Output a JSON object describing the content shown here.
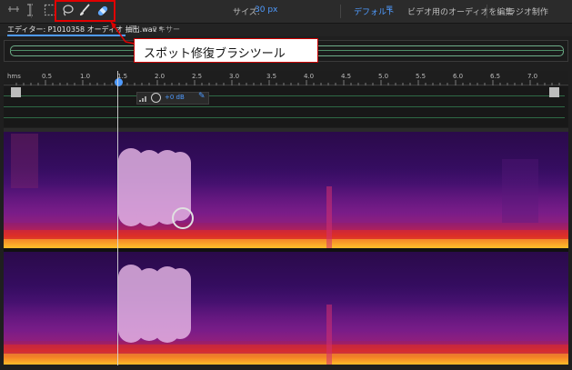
{
  "toolbar": {
    "tools": [
      {
        "icon": "waveform-view-icon"
      },
      {
        "icon": "time-selection-icon"
      },
      {
        "icon": "marquee-selection-icon"
      },
      {
        "icon": "lasso-selection-icon"
      },
      {
        "icon": "paintbrush-selection-icon"
      },
      {
        "icon": "spot-healing-brush-icon",
        "active": true
      }
    ],
    "size_label": "サイズ:",
    "size_value": "30 px",
    "workspace_default": "デフォルト",
    "workspace_menu": "≡",
    "workspace_video": "ビデオ用のオーディオを編集",
    "workspace_radio": "ラジオ制作"
  },
  "tabs": {
    "editor": "エディター: P1010358 オーディオ 抽出.wav *",
    "menu": "≡",
    "mixer": "ミキサー"
  },
  "callout": {
    "text": "スポット修復ブラシツール"
  },
  "ruler": {
    "unit": "hms",
    "labels": [
      "0.5",
      "1.0",
      "1.5",
      "2.0",
      "2.5",
      "3.0",
      "3.5",
      "4.0",
      "4.5",
      "5.0",
      "5.5",
      "6.0",
      "6.5",
      "7.0"
    ]
  },
  "hud": {
    "gain_value": "+0 dB"
  },
  "colors": {
    "accent": "#4f9bff",
    "highlight_red": "#e00000",
    "waveform_green": "#2e6a46"
  }
}
